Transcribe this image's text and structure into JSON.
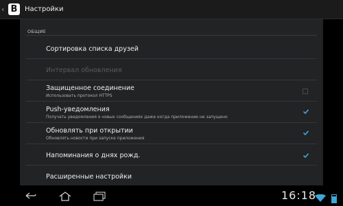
{
  "actionbar": {
    "logo_letter": "В",
    "title": "Настройки"
  },
  "section": {
    "header": "ОБЩИЕ"
  },
  "items": [
    {
      "title": "Сортировка списка друзей",
      "summary": "",
      "enabled": true,
      "checkbox": null
    },
    {
      "title": "Интервал обновления",
      "summary": "",
      "enabled": false,
      "checkbox": null
    },
    {
      "title": "Защищенное соединение",
      "summary": "Использовать протокол HTTPS",
      "enabled": true,
      "checkbox": false
    },
    {
      "title": "Push-уведомления",
      "summary": "Получать уведомления о новых сообщениях даже когда приложение не запущено",
      "enabled": true,
      "checkbox": true
    },
    {
      "title": "Обновлять при открытии",
      "summary": "Обновлять новости при запуске приложения",
      "enabled": true,
      "checkbox": true
    },
    {
      "title": "Напоминания о днях рожд.",
      "summary": "",
      "enabled": true,
      "checkbox": true
    },
    {
      "title": "Расширенные настройки",
      "summary": "",
      "enabled": true,
      "checkbox": null
    }
  ],
  "statusbar": {
    "time": "16:18"
  },
  "colors": {
    "accent": "#3fa7d6",
    "panel": "#222325"
  },
  "icons": {
    "back": "back-icon",
    "home": "home-icon",
    "recents": "recent-apps-icon",
    "wifi": "wifi-icon",
    "battery": "battery-icon"
  }
}
